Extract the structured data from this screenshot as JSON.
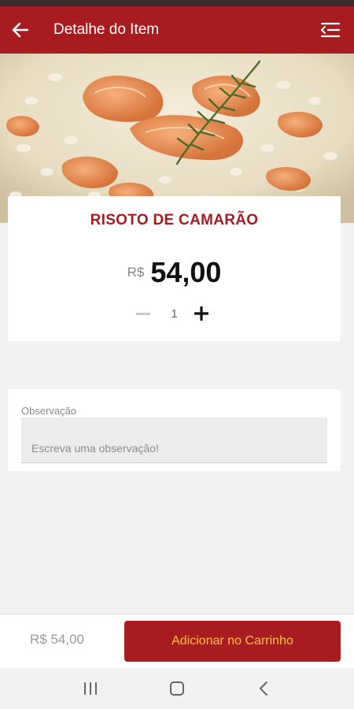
{
  "header": {
    "title": "Detalhe do Item",
    "back_icon": "arrow-left-icon",
    "menu_icon": "menu-lines-icon",
    "background_color": "#a81c1f"
  },
  "hero": {
    "image": "shrimp-risotto-photo"
  },
  "item": {
    "name": "RISOTO DE CAMARÃO",
    "currency": "R$",
    "price": "54,00",
    "quantity": "1"
  },
  "observation": {
    "label": "Observação",
    "placeholder": "Escreva uma observação!",
    "value": ""
  },
  "footer": {
    "total": "R$ 54,00",
    "add_button_label": "Adicionar no Carrinho",
    "button_color": "#a81c1f",
    "button_text_color": "#f5c342"
  },
  "system_nav": {
    "recent_icon": "recent-apps-icon",
    "home_icon": "home-icon",
    "back_icon": "back-chevron-icon"
  }
}
